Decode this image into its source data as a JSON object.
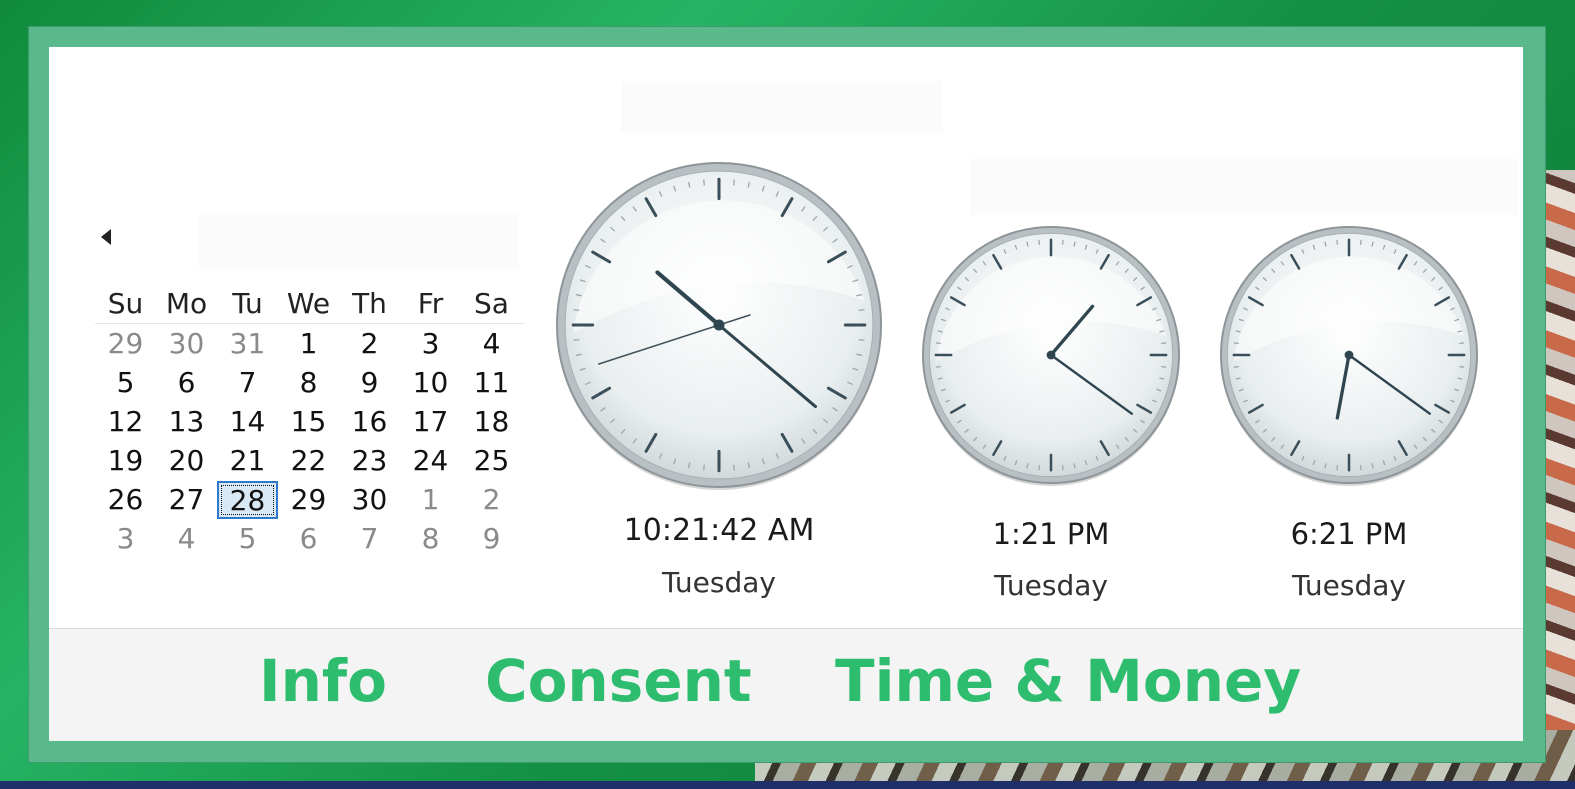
{
  "calendar": {
    "weekdays": [
      "Su",
      "Mo",
      "Tu",
      "We",
      "Th",
      "Fr",
      "Sa"
    ],
    "weeks": [
      [
        {
          "d": "29",
          "o": true
        },
        {
          "d": "30",
          "o": true
        },
        {
          "d": "31",
          "o": true
        },
        {
          "d": "1"
        },
        {
          "d": "2"
        },
        {
          "d": "3"
        },
        {
          "d": "4"
        }
      ],
      [
        {
          "d": "5"
        },
        {
          "d": "6"
        },
        {
          "d": "7"
        },
        {
          "d": "8"
        },
        {
          "d": "9"
        },
        {
          "d": "10"
        },
        {
          "d": "11"
        }
      ],
      [
        {
          "d": "12"
        },
        {
          "d": "13"
        },
        {
          "d": "14"
        },
        {
          "d": "15"
        },
        {
          "d": "16"
        },
        {
          "d": "17"
        },
        {
          "d": "18"
        }
      ],
      [
        {
          "d": "19"
        },
        {
          "d": "20"
        },
        {
          "d": "21"
        },
        {
          "d": "22"
        },
        {
          "d": "23"
        },
        {
          "d": "24"
        },
        {
          "d": "25"
        }
      ],
      [
        {
          "d": "26"
        },
        {
          "d": "27"
        },
        {
          "d": "28",
          "today": true
        },
        {
          "d": "29"
        },
        {
          "d": "30"
        },
        {
          "d": "1",
          "o": true
        },
        {
          "d": "2",
          "o": true
        }
      ],
      [
        {
          "d": "3",
          "o": true
        },
        {
          "d": "4",
          "o": true
        },
        {
          "d": "5",
          "o": true
        },
        {
          "d": "6",
          "o": true
        },
        {
          "d": "7",
          "o": true
        },
        {
          "d": "8",
          "o": true
        },
        {
          "d": "9",
          "o": true
        }
      ]
    ]
  },
  "clocks": [
    {
      "time": "10:21:42 AM",
      "day": "Tuesday",
      "hour": 10,
      "minute": 21,
      "second": 42
    },
    {
      "time": "1:21 PM",
      "day": "Tuesday",
      "hour": 13,
      "minute": 21
    },
    {
      "time": "6:21 PM",
      "day": "Tuesday",
      "hour": 18,
      "minute": 21
    }
  ],
  "footer": {
    "info_label": "Info",
    "consent_label": "Consent",
    "time_money_label": "Time & Money"
  },
  "colors": {
    "accent": "#2ebd6e",
    "frame": "#5ab98a",
    "today_fill": "#d9e8f5",
    "today_border": "#2e79c8"
  }
}
